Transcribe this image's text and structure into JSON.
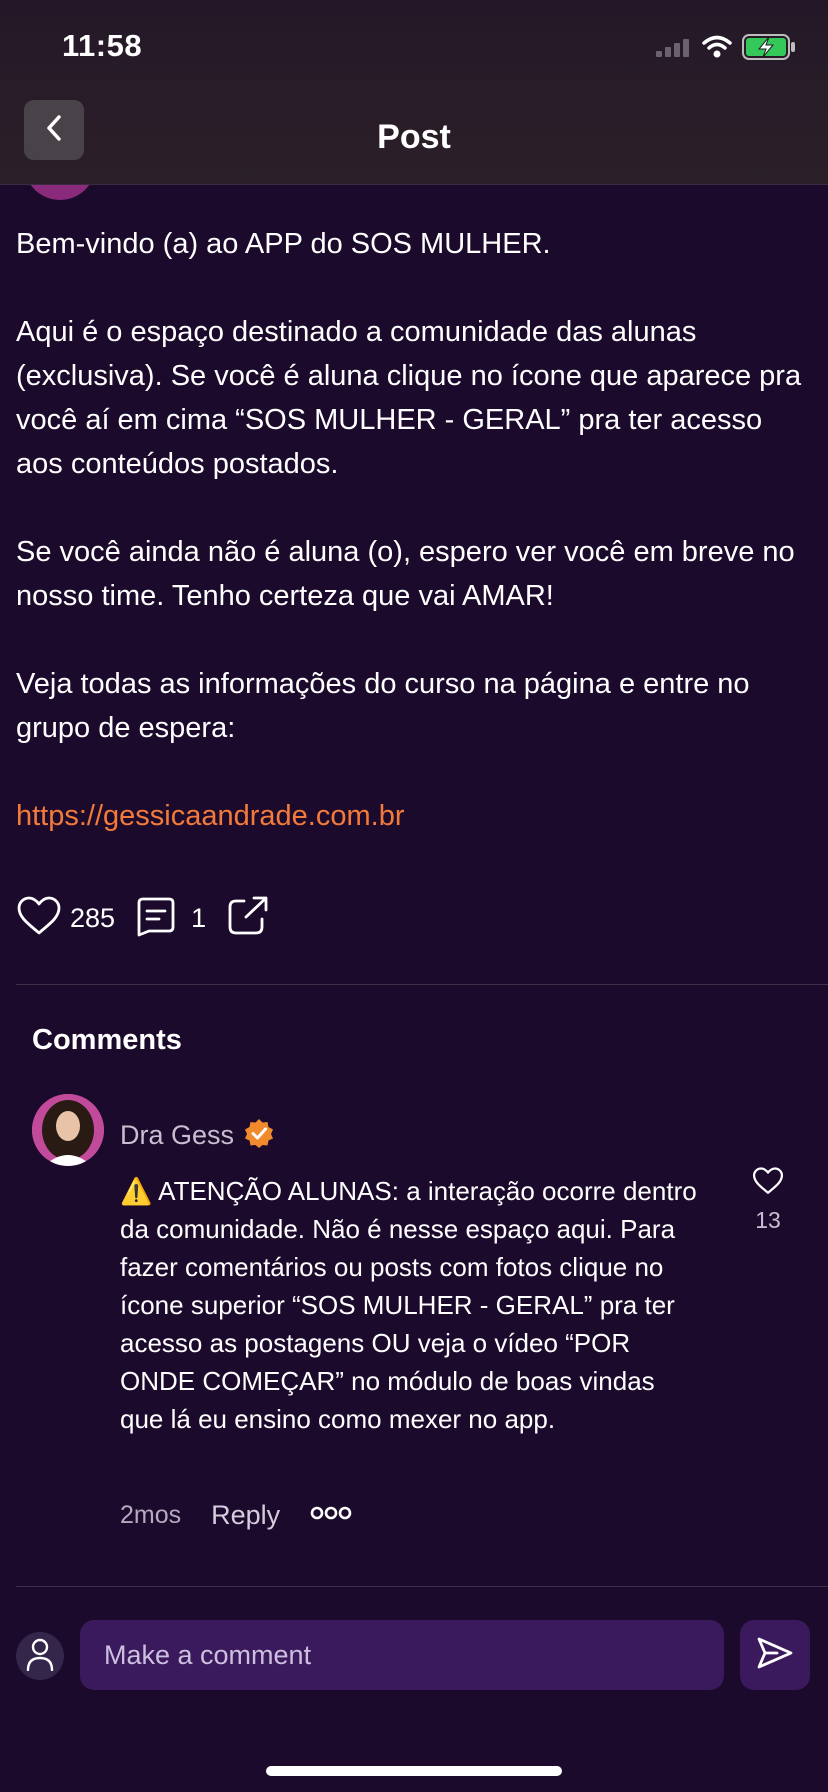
{
  "status_bar": {
    "time": "11:58",
    "icons": [
      "cellular-signal-icon",
      "wifi-icon",
      "battery-charging-icon"
    ]
  },
  "nav": {
    "title": "Post",
    "back_icon": "chevron-left-icon"
  },
  "post": {
    "paragraphs": [
      "Bem-vindo (a) ao APP do SOS MULHER.",
      "Aqui é o espaço destinado a comunidade das alunas (exclusiva). Se você é aluna clique no ícone que aparece pra você aí em cima “SOS MULHER - GERAL” pra ter acesso aos conteúdos postados.",
      "Se você ainda não é aluna (o), espero ver você em breve no nosso time. Tenho certeza que vai AMAR!",
      "Veja todas as informações do curso na página e entre no grupo de espera:"
    ],
    "link": "https://gessicaandrade.com.br",
    "like_count": "285",
    "comment_count": "1",
    "icons": {
      "like": "heart-icon",
      "comments": "comment-icon",
      "share": "share-icon"
    }
  },
  "comments": {
    "heading": "Comments",
    "items": [
      {
        "author": "Dra Gess",
        "verified_icon": "verified-badge-icon",
        "text": "⚠️ ATENÇÃO ALUNAS: a interação ocorre dentro da comunidade. Não é nesse espaço aqui. Para fazer comentários ou posts com fotos clique no ícone superior “SOS MULHER - GERAL” pra ter acesso as postagens OU veja o vídeo “POR ONDE COMEÇAR” no módulo de boas vindas que lá eu ensino como mexer no app.",
        "like_count": "13",
        "time": "2mos",
        "reply_label": "Reply",
        "more_icon": "more-options-icon"
      }
    ]
  },
  "composer": {
    "placeholder": "Make a comment",
    "user_icon": "user-icon",
    "send_icon": "send-icon"
  },
  "colors": {
    "background": "#1c0a2c",
    "link": "#f27a3a",
    "input_bg": "#3a1a5c",
    "verified_badge": "#f08a2c"
  }
}
